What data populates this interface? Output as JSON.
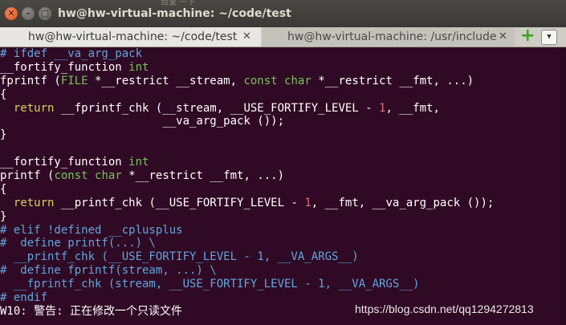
{
  "window": {
    "title": "hw@hw-virtual-machine: ~/code/test",
    "ghost_title": "目录 一下",
    "buttons": {
      "close": "✕",
      "minimize": "–",
      "maximize": "□"
    }
  },
  "tabs": [
    {
      "label": "hw@hw-virtual-machine: ~/code/test",
      "close": "✕",
      "active": true
    },
    {
      "label": "hw@hw-virtual-machine: /usr/include",
      "close": "✕",
      "active": false
    }
  ],
  "tabbar": {
    "new_tab_icon": "+",
    "menu_icon": "▼"
  },
  "colors": {
    "terminal_bg": "#300a24",
    "preprocessor": "#5fa6e0",
    "type": "#75c35a",
    "keyword": "#dcd25a",
    "number": "#e0707a",
    "text": "#ffffff"
  },
  "code_lines": [
    [
      [
        "pre",
        "# ifdef __va_arg_pack"
      ]
    ],
    [
      [
        "plain",
        "__fortify_function "
      ],
      [
        "type",
        "int"
      ]
    ],
    [
      [
        "plain",
        "fprintf ("
      ],
      [
        "type",
        "FILE"
      ],
      [
        "plain",
        " *__restrict __stream, "
      ],
      [
        "type",
        "const"
      ],
      [
        "plain",
        " "
      ],
      [
        "type",
        "char"
      ],
      [
        "plain",
        " *__restrict __fmt, ...)"
      ]
    ],
    [
      [
        "plain",
        "{"
      ]
    ],
    [
      [
        "plain",
        "  "
      ],
      [
        "kw",
        "return"
      ],
      [
        "plain",
        " __fprintf_chk (__stream, __USE_FORTIFY_LEVEL - "
      ],
      [
        "num",
        "1"
      ],
      [
        "plain",
        ", __fmt,"
      ]
    ],
    [
      [
        "plain",
        "                        __va_arg_pack ());"
      ]
    ],
    [
      [
        "plain",
        "}"
      ]
    ],
    [
      [
        "plain",
        ""
      ]
    ],
    [
      [
        "plain",
        "__fortify_function "
      ],
      [
        "type",
        "int"
      ]
    ],
    [
      [
        "plain",
        "printf ("
      ],
      [
        "type",
        "const"
      ],
      [
        "plain",
        " "
      ],
      [
        "type",
        "char"
      ],
      [
        "plain",
        " *__restrict __fmt, ...)"
      ]
    ],
    [
      [
        "plain",
        "{"
      ]
    ],
    [
      [
        "plain",
        "  "
      ],
      [
        "kw",
        "return"
      ],
      [
        "plain",
        " __printf_chk (__USE_FORTIFY_LEVEL - "
      ],
      [
        "num",
        "1"
      ],
      [
        "plain",
        ", __fmt, __va_arg_pack ());"
      ]
    ],
    [
      [
        "plain",
        "}"
      ]
    ],
    [
      [
        "pre",
        "# elif !defined __cplusplus"
      ]
    ],
    [
      [
        "pre",
        "#  define printf(...) \\"
      ]
    ],
    [
      [
        "pre",
        "  __printf_chk (__USE_FORTIFY_LEVEL - 1, __VA_ARGS__)"
      ]
    ],
    [
      [
        "pre",
        "#  define fprintf(stream, ...) \\"
      ]
    ],
    [
      [
        "pre",
        "  __fprintf_chk (stream, __USE_FORTIFY_LEVEL - 1, __VA_ARGS__)"
      ]
    ],
    [
      [
        "pre",
        "# endif"
      ]
    ],
    [
      [
        "warn",
        "W10: 警告: 正在修改一个只读文件"
      ]
    ]
  ],
  "watermark": "https://blog.csdn.net/qq1294272813"
}
